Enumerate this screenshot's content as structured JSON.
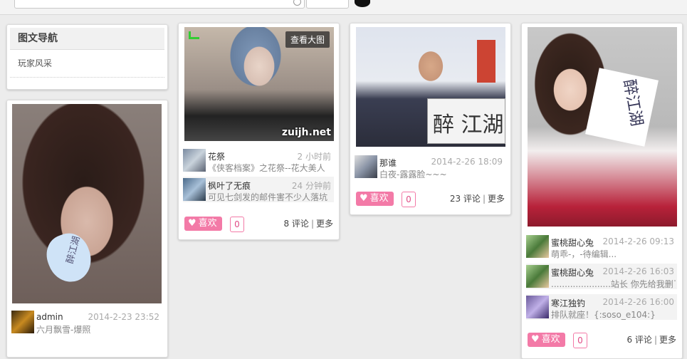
{
  "search": {
    "placeholder": ""
  },
  "nav": {
    "title": "图文导航",
    "items": [
      "玩家风采"
    ]
  },
  "posts": [
    {
      "comments": [
        {
          "user": "admin",
          "time": "2014-2-23 23:52",
          "text": "六月飘雪-爆照"
        }
      ]
    },
    {
      "overlay": "查看大图",
      "watermark": "zuijh.net",
      "comments": [
        {
          "user": "花祭",
          "time": "2 小时前",
          "text": "《侠客档案》之花祭--花大美人"
        },
        {
          "user": "枫叶了无痕",
          "time": "24 分钟前",
          "text": "可见七剑发的邮件害不少人落坑"
        }
      ],
      "like_label": "喜欢",
      "like_count": "0",
      "comment_count": "8 评论",
      "more": "更多"
    },
    {
      "sign": "醉 江湖",
      "comments": [
        {
          "user": "那谁",
          "time": "2014-2-26 18:09",
          "text": "白夜-露露脸~~~"
        }
      ],
      "like_label": "喜欢",
      "like_count": "0",
      "comment_count": "23 评论",
      "more": "更多"
    },
    {
      "note": "醉江湖",
      "comments": [
        {
          "user": "蜜桃甜心兔",
          "time": "2014-2-26 09:13",
          "text": "萌乖-，-待编辑..."
        },
        {
          "user": "蜜桃甜心兔",
          "time": "2014-2-26 16:03",
          "text": "......................站长 你先给我删了"
        },
        {
          "user": "寒江独钓",
          "time": "2014-2-26 16:00",
          "text": "排队就座！{:soso_e104:}"
        }
      ],
      "like_label": "喜欢",
      "like_count": "0",
      "comment_count": "6 评论",
      "more": "更多"
    }
  ],
  "colors": {
    "like": "#f37aa7",
    "background": "#ececec"
  }
}
